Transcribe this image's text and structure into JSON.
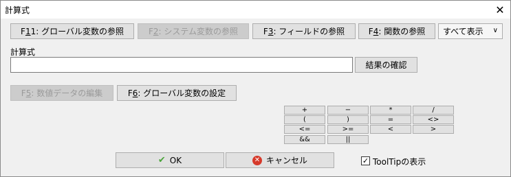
{
  "window": {
    "title": "計算式",
    "close_glyph": "✕"
  },
  "toolbar": {
    "f11": {
      "key_prefix": "F",
      "key_u": "1",
      "key_suffix": "1",
      "label": " : グローバル変数の参照"
    },
    "f2": {
      "key_prefix": "F",
      "key_u": "2",
      "label": " : システム変数の参照"
    },
    "f3": {
      "key_prefix": "F",
      "key_u": "3",
      "label": " : フィールドの参照"
    },
    "f4": {
      "key_prefix": "F",
      "key_u": "4",
      "label": " : 関数の参照"
    },
    "filter_select": {
      "value": "すべて表示",
      "chevron": "∨"
    }
  },
  "formula": {
    "label": "計算式",
    "value": "",
    "confirm_button": "結果の確認"
  },
  "actions": {
    "f5": {
      "key_prefix": "F",
      "key_u": "5",
      "label": " : 数値データの編集"
    },
    "f6": {
      "key_prefix": "F",
      "key_u": "6",
      "label": " : グローバル変数の設定"
    }
  },
  "operators": [
    "+",
    "−",
    "*",
    "/",
    "(",
    ")",
    "=",
    "<>",
    "<=",
    ">=",
    "<",
    ">",
    "&&",
    "||"
  ],
  "footer": {
    "ok_label": "OK",
    "cancel_label": "キャンセル",
    "tooltip_label": "ToolTipの表示",
    "tooltip_checked": "✓"
  },
  "colors": {
    "ok_icon": "#4aa43a",
    "cancel_icon": "#d63a2b"
  }
}
